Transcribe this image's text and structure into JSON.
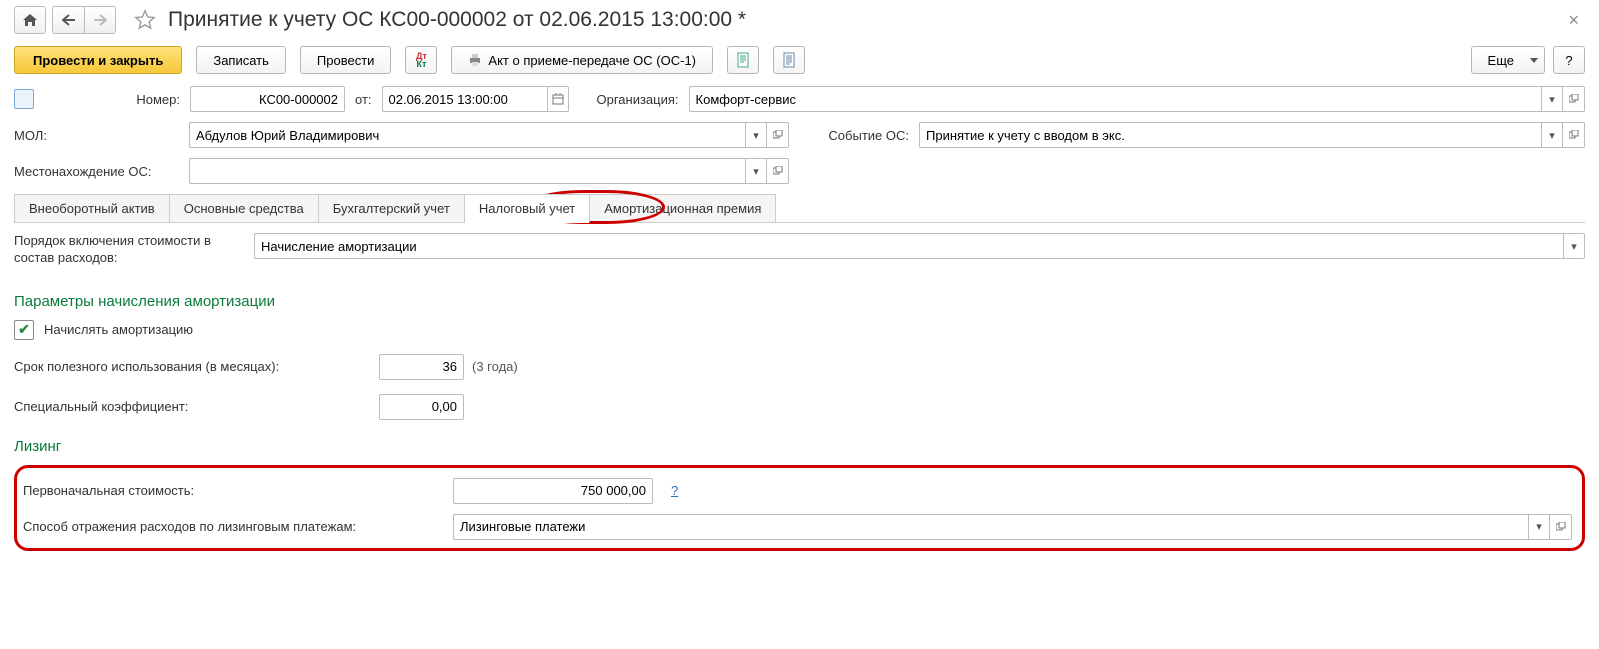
{
  "header": {
    "title": "Принятие к учету ОС КС00-000002 от 02.06.2015 13:00:00 *"
  },
  "toolbar": {
    "submit_close": "Провести и закрыть",
    "save": "Записать",
    "submit": "Провести",
    "print_os1": "Акт о приеме-передаче ОС (ОС-1)",
    "more": "Еще",
    "help": "?"
  },
  "fields": {
    "number_label": "Номер:",
    "number": "КС00-000002",
    "from_label": "от:",
    "date": "02.06.2015 13:00:00",
    "org_label": "Организация:",
    "org": "Комфорт-сервис",
    "mol_label": "МОЛ:",
    "mol": "Абдулов Юрий Владимирович",
    "event_label": "Событие ОС:",
    "event": "Принятие к учету с вводом в экс.",
    "location_label": "Местонахождение ОС:",
    "location": ""
  },
  "tabs": {
    "t1": "Внеоборотный актив",
    "t2": "Основные средства",
    "t3": "Бухгалтерский учет",
    "t4": "Налоговый учет",
    "t5": "Амортизационная премия"
  },
  "tax": {
    "order_label": "Порядок включения стоимости в состав расходов:",
    "order_value": "Начисление амортизации",
    "section_amort": "Параметры начисления амортизации",
    "calc_amort": "Начислять амортизацию",
    "useful_life_label": "Срок полезного использования (в месяцах):",
    "useful_life": "36",
    "useful_life_hint": "(3 года)",
    "coeff_label": "Специальный коэффициент:",
    "coeff": "0,00",
    "section_leasing": "Лизинг",
    "initial_cost_label": "Первоначальная стоимость:",
    "initial_cost": "750 000,00",
    "q": "?",
    "leasing_method_label": "Способ отражения расходов по лизинговым платежам:",
    "leasing_method": "Лизинговые платежи"
  }
}
